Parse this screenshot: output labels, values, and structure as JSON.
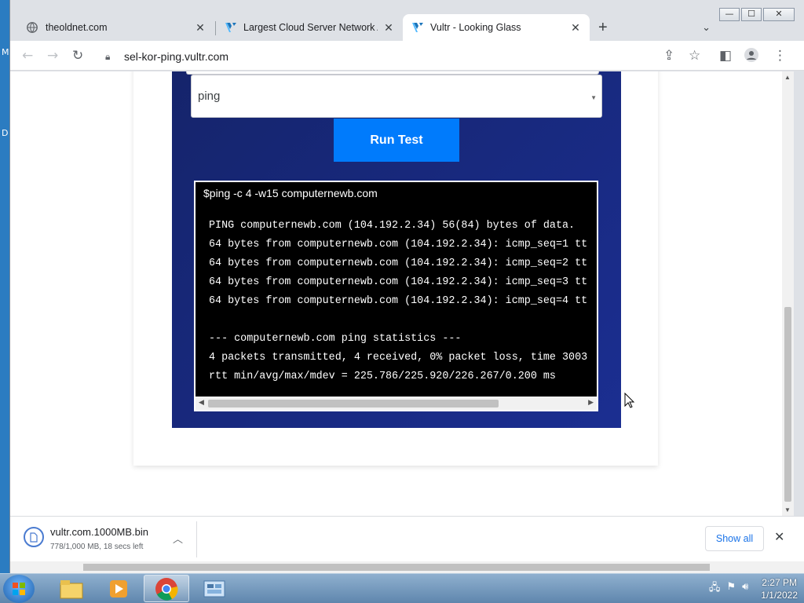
{
  "desktop": {
    "letters": [
      "M",
      "D"
    ]
  },
  "window_controls": {
    "minimize": "—",
    "maximize": "☐",
    "close": "✕"
  },
  "tabs": [
    {
      "title": "theoldnet.com",
      "close": "✕"
    },
    {
      "title": "Largest Cloud Server Network A",
      "close": "✕"
    },
    {
      "title": "Vultr - Looking Glass",
      "close": "✕"
    }
  ],
  "new_tab": "+",
  "tab_menu": "⌄",
  "toolbar": {
    "url": "sel-kor-ping.vultr.com"
  },
  "page": {
    "select_value": "ping",
    "run_button": "Run Test",
    "terminal": {
      "command": "$ping -c 4 -w15 computernewb.com",
      "lines": [
        "PING computernewb.com (104.192.2.34) 56(84) bytes of data.",
        "64 bytes from computernewb.com (104.192.2.34): icmp_seq=1 tt",
        "64 bytes from computernewb.com (104.192.2.34): icmp_seq=2 tt",
        "64 bytes from computernewb.com (104.192.2.34): icmp_seq=3 tt",
        "64 bytes from computernewb.com (104.192.2.34): icmp_seq=4 tt",
        "",
        "--- computernewb.com ping statistics ---",
        "4 packets transmitted, 4 received, 0% packet loss, time 3003",
        "rtt min/avg/max/mdev = 225.786/225.920/226.267/0.200 ms"
      ]
    }
  },
  "downloads": {
    "file_name": "vultr.com.1000MB.bin",
    "status": "778/1,000 MB, 18 secs left",
    "show_all": "Show all",
    "close": "✕"
  },
  "taskbar": {
    "clock_time": "2:27 PM",
    "clock_date": "1/1/2022"
  },
  "colors": {
    "panel": "#1b2e91",
    "run_button": "#007bfc",
    "accent": "#1a73e8"
  }
}
